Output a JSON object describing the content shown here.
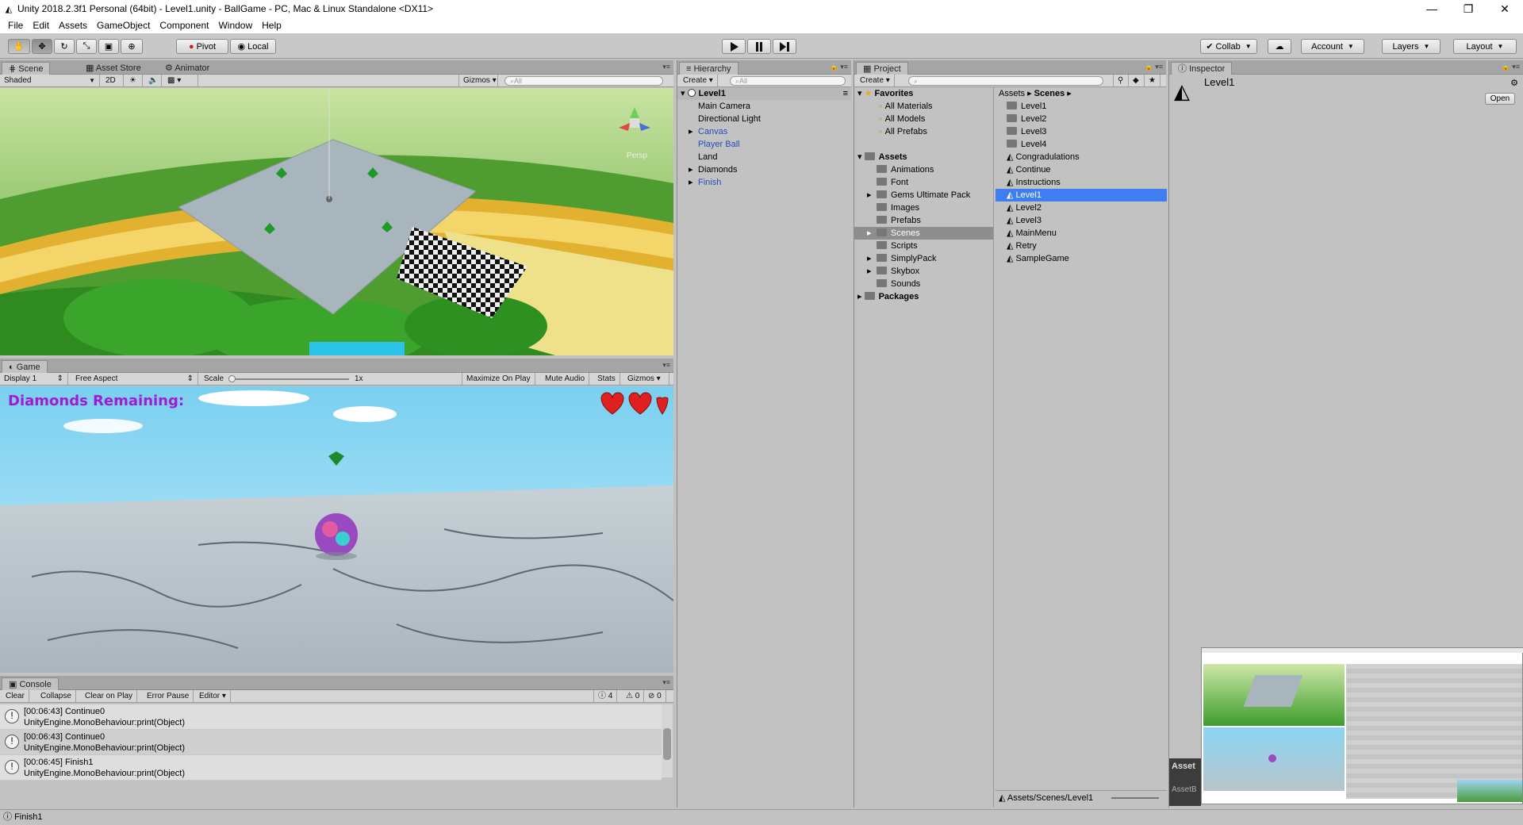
{
  "titlebar": {
    "title": "Unity 2018.2.3f1 Personal (64bit) - Level1.unity - BallGame - PC, Mac & Linux Standalone <DX11>"
  },
  "menu": [
    "File",
    "Edit",
    "Assets",
    "GameObject",
    "Component",
    "Window",
    "Help"
  ],
  "toolbar": {
    "pivot": "Pivot",
    "local": "Local",
    "collab": "Collab",
    "account": "Account",
    "layers": "Layers",
    "layout": "Layout"
  },
  "scene": {
    "tabs": [
      "Scene",
      "Asset Store",
      "Animator"
    ],
    "shading": "Shaded",
    "mode_2d": "2D",
    "gizmos": "Gizmos",
    "search": "All",
    "persp": "Persp"
  },
  "game": {
    "tab": "Game",
    "display": "Display 1",
    "aspect": "Free Aspect",
    "scale_label": "Scale",
    "scale_value": "1x",
    "maximize": "Maximize On Play",
    "mute": "Mute Audio",
    "stats": "Stats",
    "gizmos": "Gizmos",
    "hud_text": "Diamonds Remaining:"
  },
  "console": {
    "tab": "Console",
    "buttons": [
      "Clear",
      "Collapse",
      "Clear on Play",
      "Error Pause",
      "Editor"
    ],
    "counts": {
      "log": "4",
      "warn": "0",
      "error": "0"
    },
    "entries": [
      {
        "line1": "[00:06:43] Continue0",
        "line2": "UnityEngine.MonoBehaviour:print(Object)"
      },
      {
        "line1": "[00:06:43] Continue0",
        "line2": "UnityEngine.MonoBehaviour:print(Object)"
      },
      {
        "line1": "[00:06:45] Finish1",
        "line2": "UnityEngine.MonoBehaviour:print(Object)"
      }
    ]
  },
  "status": {
    "text": "Finish1"
  },
  "hierarchy": {
    "tab": "Hierarchy",
    "create": "Create",
    "search": "All",
    "scene": "Level1",
    "items": [
      {
        "label": "Main Camera",
        "blue": false,
        "arrow": false
      },
      {
        "label": "Directional Light",
        "blue": false,
        "arrow": false
      },
      {
        "label": "Canvas",
        "blue": true,
        "arrow": true
      },
      {
        "label": "Player Ball",
        "blue": true,
        "arrow": false
      },
      {
        "label": "Land",
        "blue": false,
        "arrow": false
      },
      {
        "label": "Diamonds",
        "blue": false,
        "arrow": true
      },
      {
        "label": "Finish",
        "blue": true,
        "arrow": true
      }
    ]
  },
  "project": {
    "tab": "Project",
    "create": "Create",
    "favorites": "Favorites",
    "fav_items": [
      "All Materials",
      "All Models",
      "All Prefabs"
    ],
    "assets": "Assets",
    "folders": [
      {
        "label": "Animations",
        "arrow": false
      },
      {
        "label": "Font",
        "arrow": false
      },
      {
        "label": "Gems Ultimate Pack",
        "arrow": true
      },
      {
        "label": "Images",
        "arrow": false
      },
      {
        "label": "Prefabs",
        "arrow": false
      },
      {
        "label": "Scenes",
        "arrow": true,
        "selected": true
      },
      {
        "label": "Scripts",
        "arrow": false
      },
      {
        "label": "SimplyPack",
        "arrow": true
      },
      {
        "label": "Skybox",
        "arrow": true
      },
      {
        "label": "Sounds",
        "arrow": false
      }
    ],
    "packages": "Packages",
    "breadcrumb": [
      "Assets",
      "Scenes"
    ],
    "files": [
      {
        "label": "Level1",
        "type": "folder"
      },
      {
        "label": "Level2",
        "type": "folder"
      },
      {
        "label": "Level3",
        "type": "folder"
      },
      {
        "label": "Level4",
        "type": "folder"
      },
      {
        "label": "Congradulations",
        "type": "scene"
      },
      {
        "label": "Continue",
        "type": "scene"
      },
      {
        "label": "Instructions",
        "type": "scene"
      },
      {
        "label": "Level1",
        "type": "scene",
        "selected": true
      },
      {
        "label": "Level2",
        "type": "scene"
      },
      {
        "label": "Level3",
        "type": "scene"
      },
      {
        "label": "MainMenu",
        "type": "scene"
      },
      {
        "label": "Retry",
        "type": "scene"
      },
      {
        "label": "SampleGame",
        "type": "scene"
      }
    ],
    "footer_path": "Assets/Scenes/Level1"
  },
  "inspector": {
    "tab": "Inspector",
    "name": "Level1",
    "open": "Open",
    "asset_label": "Asset",
    "asset_bundle": "AssetB"
  },
  "colors": {
    "selection": "#3d7ff0",
    "panel": "#c2c2c2",
    "blue_prefab": "#1f4fb8"
  }
}
